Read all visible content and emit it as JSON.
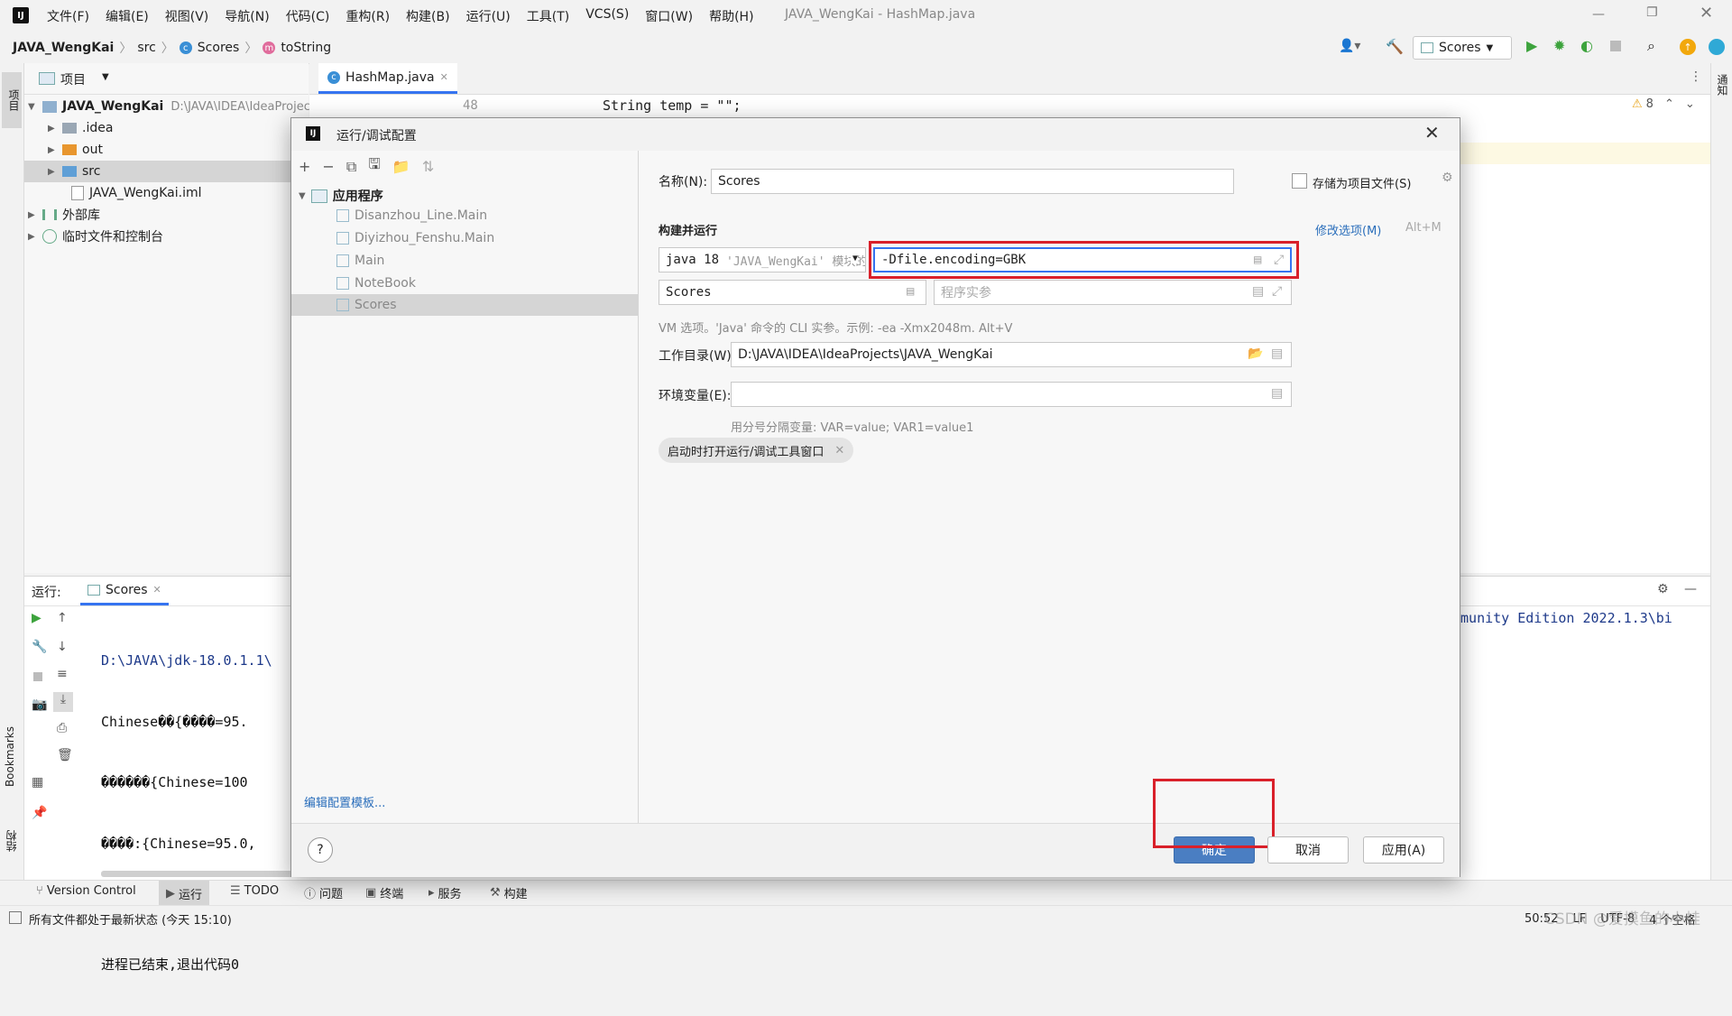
{
  "app": {
    "menu": [
      "文件(F)",
      "编辑(E)",
      "视图(V)",
      "导航(N)",
      "代码(C)",
      "重构(R)",
      "构建(B)",
      "运行(U)",
      "工具(T)",
      "VCS(S)",
      "窗口(W)",
      "帮助(H)"
    ],
    "window_title": "JAVA_WengKai - HashMap.java"
  },
  "breadcrumb": {
    "project": "JAVA_WengKai",
    "folder": "src",
    "class": "Scores",
    "method": "toString"
  },
  "toolbar": {
    "run_config": "Scores"
  },
  "project_panel": {
    "title": "项目",
    "root_name": "JAVA_WengKai",
    "root_path": "D:\\JAVA\\IDEA\\IdeaProjects\\JAVA_WengKai",
    "items": [
      ".idea",
      "out",
      "src",
      "JAVA_WengKai.iml",
      "外部库",
      "临时文件和控制台"
    ]
  },
  "left_strip": {
    "project_label": "项目",
    "bookmarks_label": "Bookmarks",
    "structure_label": "结构"
  },
  "right_strip": {
    "label": "通知"
  },
  "editor": {
    "tab": "HashMap.java",
    "line_number": "48",
    "code_line": "String temp = \"\";",
    "warnings": "8"
  },
  "run_panel": {
    "label": "运行:",
    "tab": "Scores",
    "lines": [
      "D:\\JAVA\\jdk-18.0.1.1\\",
      "Chinese��{����=95.",
      "������{Chinese=100",
      "����:{Chinese=95.0,",
      "",
      "进程已结束,退出代码0"
    ],
    "right_text": "mmunity Edition 2022.1.3\\bi"
  },
  "dialog": {
    "title": "运行/调试配置",
    "tree_root": "应用程序",
    "tree_items": [
      "Disanzhou_Line.Main",
      "Diyizhou_Fenshu.Main",
      "Main",
      "NoteBook",
      "Scores"
    ],
    "edit_templates": "编辑配置模板...",
    "name_label": "名称(N):",
    "name_value": "Scores",
    "store_label": "存储为项目文件(S)",
    "section_build_run": "构建并运行",
    "modify_options": "修改选项(M)",
    "modify_shortcut": "Alt+M",
    "jdk": "java 18",
    "jdk_detail": "'JAVA_WengKai' 模块的",
    "vm_options": "-Dfile.encoding=GBK",
    "main_class": "Scores",
    "program_args_placeholder": "程序实参",
    "vm_hint": "VM 选项。'Java' 命令的 CLI 实参。示例: -ea -Xmx2048m. Alt+V",
    "workdir_label": "工作目录(W):",
    "workdir_value": "D:\\JAVA\\IDEA\\IdeaProjects\\JAVA_WengKai",
    "env_label": "环境变量(E):",
    "env_value": "",
    "env_hint": "用分号分隔变量: VAR=value; VAR1=value1",
    "chip": "启动时打开运行/调试工具窗口",
    "ok": "确定",
    "cancel": "取消",
    "apply": "应用(A)",
    "help": "?"
  },
  "bottom_tools": [
    "Version Control",
    "运行",
    "TODO",
    "问题",
    "终端",
    "服务",
    "构建"
  ],
  "status": {
    "left": "所有文件都处于最新状态 (今天 15:10)",
    "position": "50:52",
    "line_sep": "LF",
    "encoding": "UTF-8",
    "indent": "4 个空格",
    "watermark": "CSDN @爱摸鱼的小蛙"
  },
  "colors": {
    "accent": "#3574f0",
    "primary_button": "#4a7ec2",
    "highlight_box": "#d9202a"
  }
}
